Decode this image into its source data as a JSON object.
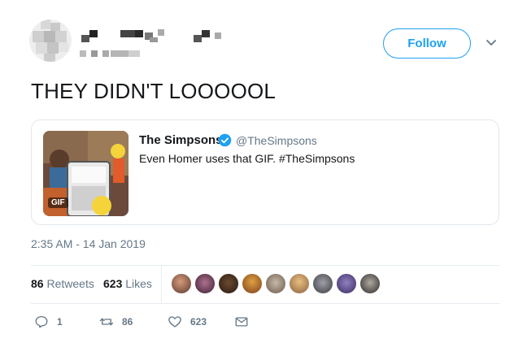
{
  "header": {
    "follow_label": "Follow"
  },
  "tweet": {
    "text": "THEY DIDN'T LOOOOOL",
    "timestamp": "2:35 AM - 14 Jan 2019"
  },
  "quote": {
    "name": "The Simpsons",
    "handle": "@TheSimpsons",
    "text": "Even Homer uses that GIF. #TheSimpsons",
    "media_badge": "GIF",
    "verified": true
  },
  "stats": {
    "retweets_count": "86",
    "retweets_label": "Retweets",
    "likes_count": "623",
    "likes_label": "Likes"
  },
  "actions": {
    "reply_count": "1",
    "retweet_count": "86",
    "like_count": "623"
  },
  "colors": {
    "accent": "#1da1f2",
    "secondary_text": "#657786",
    "border": "#e1e8ed"
  }
}
